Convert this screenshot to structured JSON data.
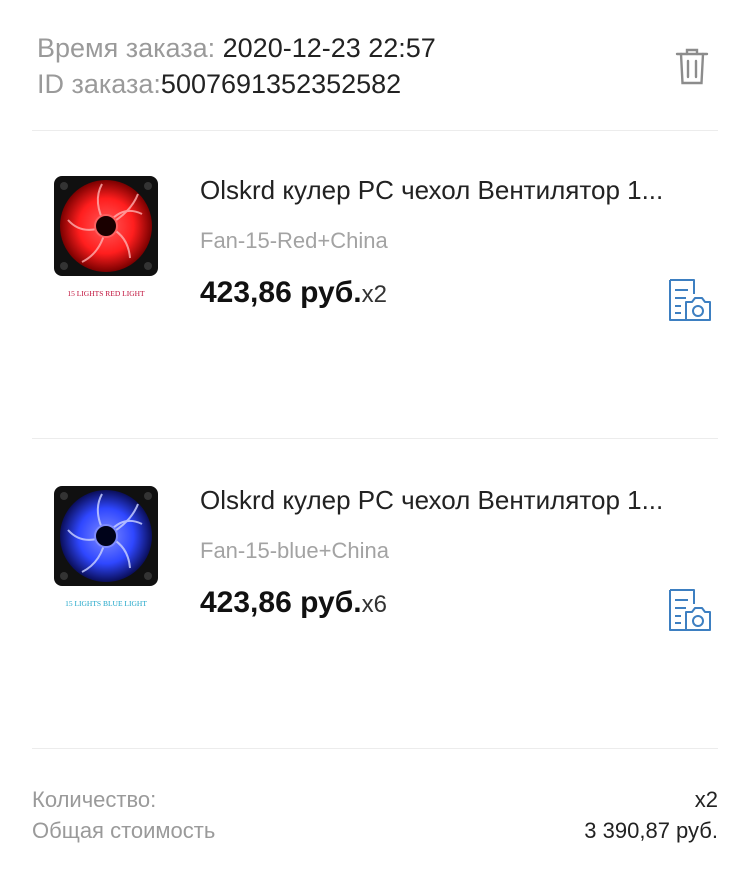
{
  "order": {
    "time_label": "Время заказа: ",
    "time_value": "2020-12-23 22:57",
    "id_label": "ID заказа:",
    "id_value": "5007691352352582"
  },
  "products": [
    {
      "title": "Olskrd кулер PC чехол Вентилятор 1...",
      "variant": "Fan-15-Red+China",
      "price": "423,86 руб.",
      "quantity": "x2",
      "image_caption": "15 LIGHTS RED LIGHT",
      "led_color": "#ff1e1e"
    },
    {
      "title": "Olskrd кулер PC чехол Вентилятор 1...",
      "variant": "Fan-15-blue+China",
      "price": "423,86 руб.",
      "quantity": "x6",
      "image_caption": "15 LIGHTS BLUE LIGHT",
      "led_color": "#2f47ff"
    }
  ],
  "summary": {
    "count_label": "Количество:",
    "count_value": "x2",
    "total_label": "Общая стоимость",
    "total_value": "3 390,87 руб."
  },
  "colors": {
    "accent": "#3d7fc1",
    "muted": "#9a9a9a",
    "divider": "#ececec"
  },
  "icons": {
    "delete": "trash-icon",
    "review": "photo-review-icon"
  }
}
